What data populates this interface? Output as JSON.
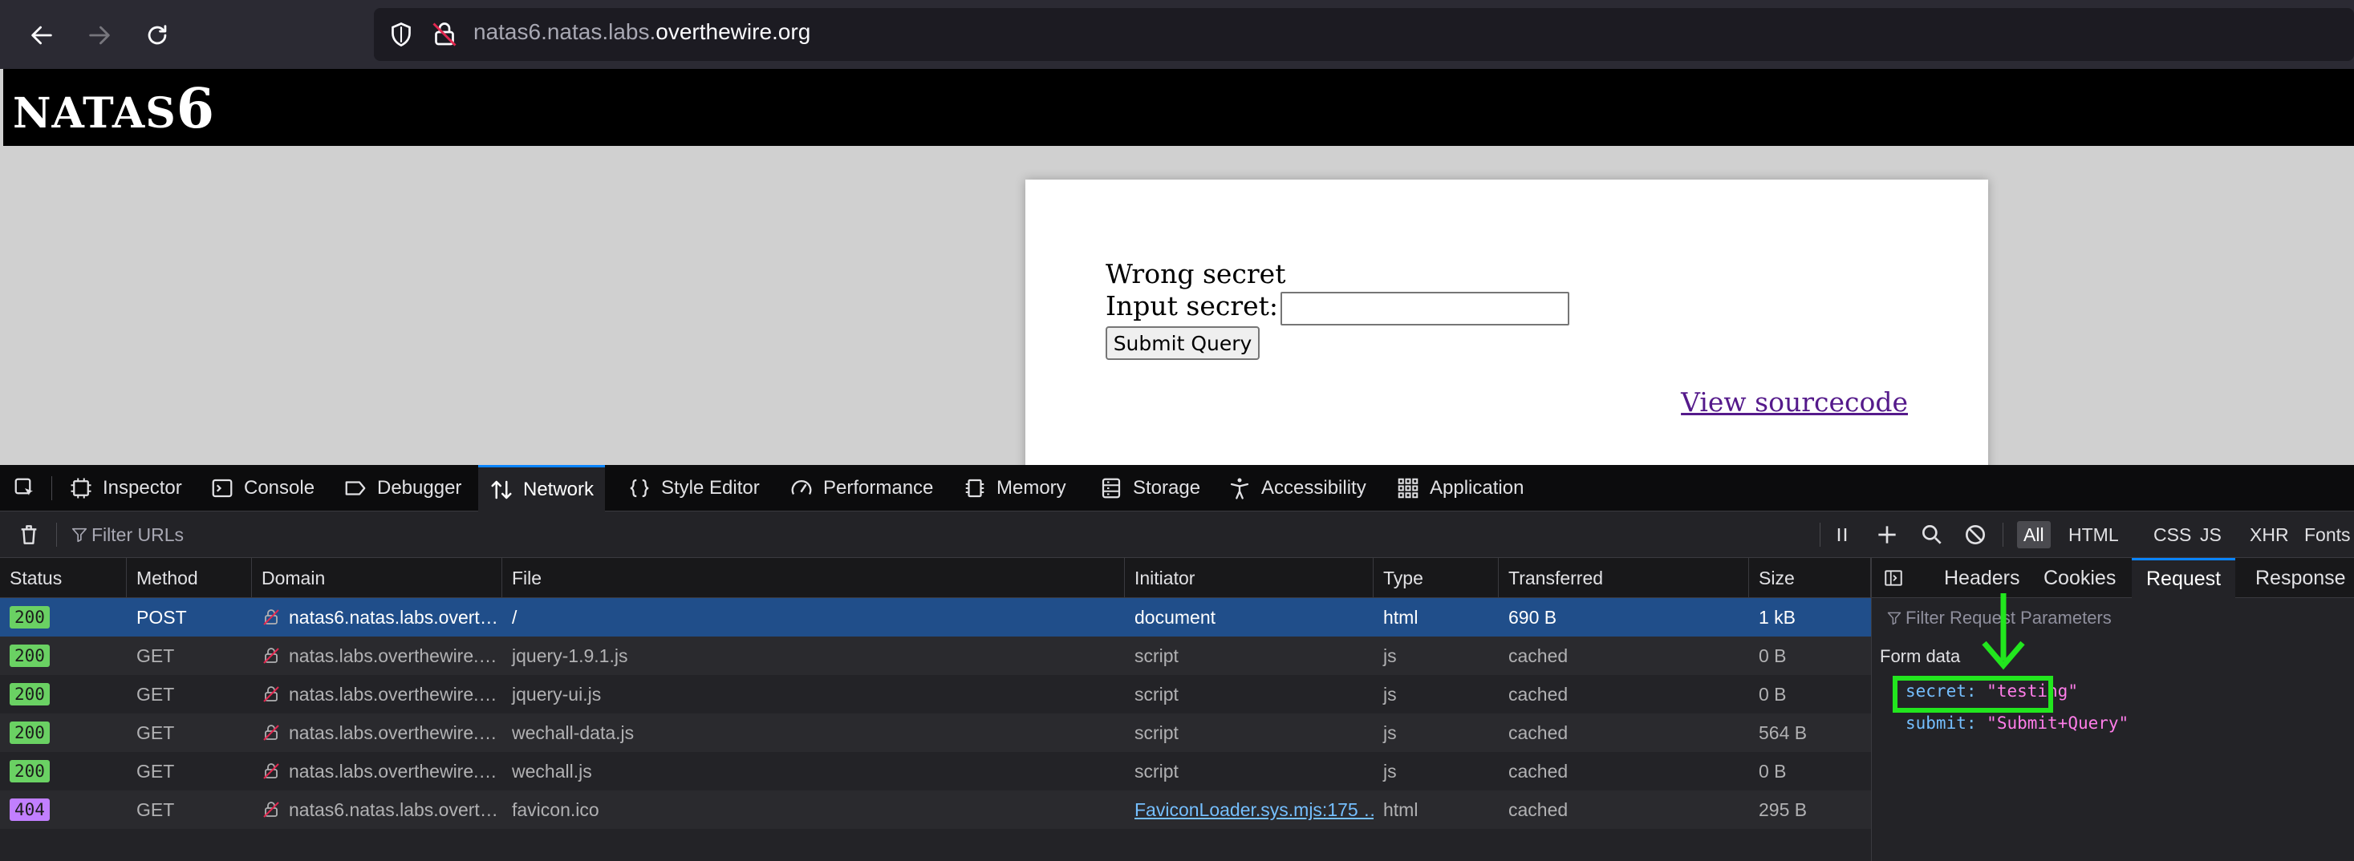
{
  "browser": {
    "url_subdomain": "natas6.natas.labs.",
    "url_domain": "overthewire.org"
  },
  "page": {
    "header_prefix": "NATAS",
    "header_number": "6",
    "message": "Wrong secret",
    "input_label": "Input secret:",
    "input_value": "",
    "submit_label": "Submit Query",
    "source_link": "View sourcecode"
  },
  "devtools": {
    "tabs": [
      {
        "label": "Inspector",
        "icon": "inspector-icon"
      },
      {
        "label": "Console",
        "icon": "console-icon"
      },
      {
        "label": "Debugger",
        "icon": "debugger-icon"
      },
      {
        "label": "Network",
        "icon": "network-icon",
        "active": true
      },
      {
        "label": "Style Editor",
        "icon": "braces-icon"
      },
      {
        "label": "Performance",
        "icon": "gauge-icon"
      },
      {
        "label": "Memory",
        "icon": "chip-icon"
      },
      {
        "label": "Storage",
        "icon": "storage-icon"
      },
      {
        "label": "Accessibility",
        "icon": "accessibility-icon"
      },
      {
        "label": "Application",
        "icon": "grid-icon"
      }
    ],
    "network": {
      "filter_placeholder": "Filter URLs",
      "type_filters": [
        "All",
        "HTML",
        "CSS",
        "JS",
        "XHR",
        "Fonts"
      ],
      "active_type_filter": "All",
      "columns": [
        "Status",
        "Method",
        "Domain",
        "File",
        "Initiator",
        "Type",
        "Transferred",
        "Size"
      ],
      "rows": [
        {
          "status": "200",
          "method": "POST",
          "domain": "natas6.natas.labs.overt…",
          "file": "/",
          "initiator": "document",
          "type": "html",
          "transferred": "690 B",
          "size": "1 kB",
          "selected": true
        },
        {
          "status": "200",
          "method": "GET",
          "domain": "natas.labs.overthewire.…",
          "file": "jquery-1.9.1.js",
          "initiator": "script",
          "type": "js",
          "transferred": "cached",
          "size": "0 B"
        },
        {
          "status": "200",
          "method": "GET",
          "domain": "natas.labs.overthewire.…",
          "file": "jquery-ui.js",
          "initiator": "script",
          "type": "js",
          "transferred": "cached",
          "size": "0 B"
        },
        {
          "status": "200",
          "method": "GET",
          "domain": "natas.labs.overthewire.…",
          "file": "wechall-data.js",
          "initiator": "script",
          "type": "js",
          "transferred": "cached",
          "size": "564 B"
        },
        {
          "status": "200",
          "method": "GET",
          "domain": "natas.labs.overthewire.…",
          "file": "wechall.js",
          "initiator": "script",
          "type": "js",
          "transferred": "cached",
          "size": "0 B"
        },
        {
          "status": "404",
          "method": "GET",
          "domain": "natas6.natas.labs.overt…",
          "file": "favicon.ico",
          "initiator": "FaviconLoader.sys.mjs:175 …",
          "type": "html",
          "transferred": "cached",
          "size": "295 B"
        }
      ],
      "status_colors": {
        "200": "#6ad163",
        "404": "#c17fff"
      }
    },
    "side_panel": {
      "tabs": [
        "Headers",
        "Cookies",
        "Request",
        "Response"
      ],
      "active_tab": "Request",
      "filter_placeholder": "Filter Request Parameters",
      "form_heading": "Form data",
      "params": [
        {
          "key": "secret:",
          "value": "\"testing\""
        },
        {
          "key": "submit:",
          "value": "\"Submit+Query\""
        }
      ]
    }
  }
}
